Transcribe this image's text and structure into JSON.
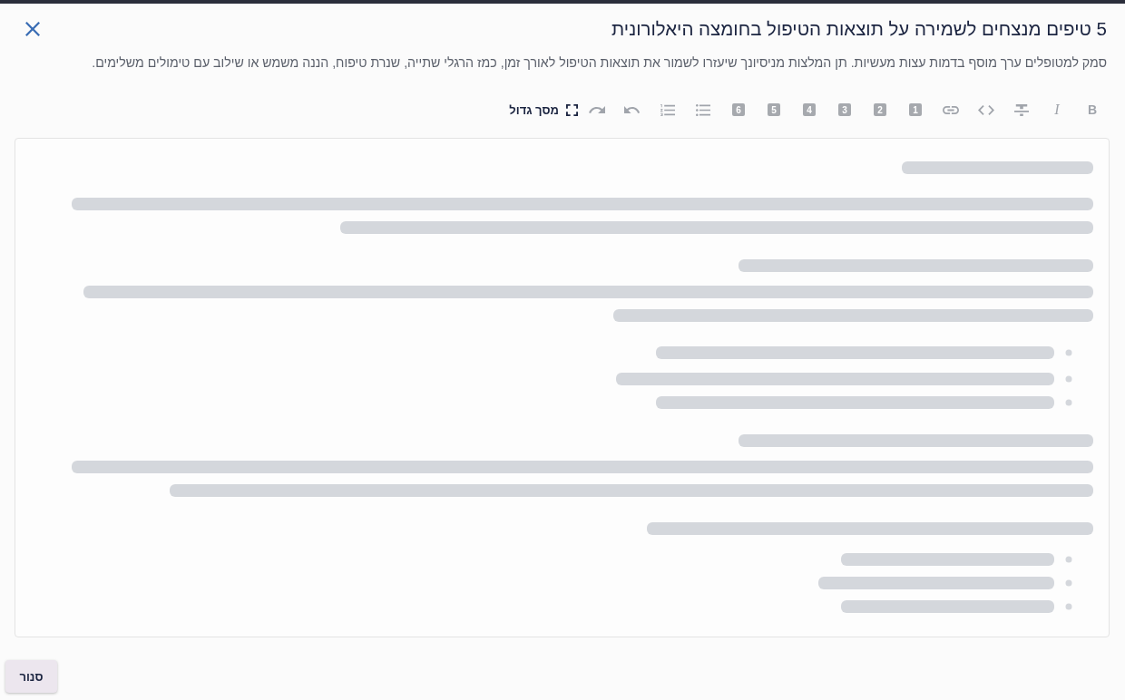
{
  "dialog": {
    "title": "5 טיפים מנצחים לשמירה על תוצאות הטיפול בחומצה היאלורונית",
    "description": "סמק למטופלים ערך מוסף בדמות עצות מעשיות. תן המלצות מניסיונך שיעזרו לשמור את תוצאות הטיפול לאורך זמן, כמז הרגלי שתייה, שנרת טיפוח, הננה משמש או שילוב עם טימולים משלימים."
  },
  "toolbar": [
    {
      "kind": "bold",
      "label": "B",
      "disabled": true
    },
    {
      "kind": "italic",
      "label": "I",
      "disabled": true
    },
    {
      "kind": "strike",
      "disabled": true
    },
    {
      "kind": "code",
      "disabled": true
    },
    {
      "kind": "link",
      "disabled": true
    },
    {
      "kind": "heading",
      "label": "1",
      "disabled": true
    },
    {
      "kind": "heading",
      "label": "2",
      "disabled": true
    },
    {
      "kind": "heading",
      "label": "3",
      "disabled": true
    },
    {
      "kind": "heading",
      "label": "4",
      "disabled": true
    },
    {
      "kind": "heading",
      "label": "5",
      "disabled": true
    },
    {
      "kind": "heading",
      "label": "6",
      "disabled": true
    },
    {
      "kind": "bullet-list",
      "disabled": true
    },
    {
      "kind": "numbered-list",
      "disabled": true
    },
    {
      "kind": "undo",
      "disabled": true
    },
    {
      "kind": "redo",
      "disabled": true
    },
    {
      "kind": "fullscreen",
      "label": "מסך גדול",
      "disabled": false
    }
  ],
  "editor": {
    "loading": true
  },
  "footer": {
    "close_button": "סנור"
  }
}
